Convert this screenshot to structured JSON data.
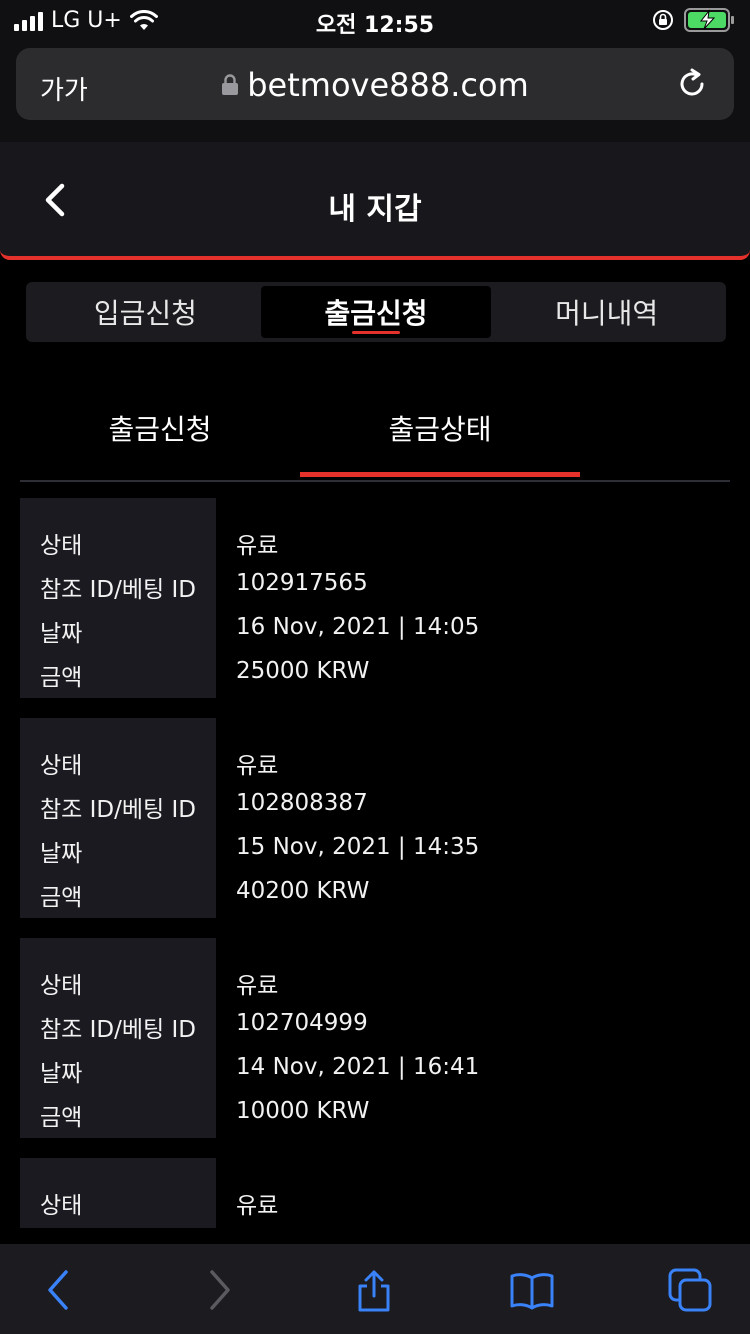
{
  "status_bar": {
    "carrier": "LG U+",
    "time": "오전 12:55"
  },
  "browser": {
    "text_size_label": "가가",
    "url": "betmove888.com"
  },
  "header": {
    "title": "내 지갑"
  },
  "segment_tabs": [
    {
      "label": "입금신청",
      "active": false
    },
    {
      "label": "출금신청",
      "active": true
    },
    {
      "label": "머니내역",
      "active": false
    }
  ],
  "sub_tabs": [
    {
      "label": "출금신청",
      "active": false
    },
    {
      "label": "출금상태",
      "active": true
    }
  ],
  "field_labels": {
    "status": "상태",
    "ref": "참조 ID/베팅 ID",
    "date": "날짜",
    "amount": "금액"
  },
  "records": [
    {
      "status": "유료",
      "ref": "102917565",
      "date": "16 Nov, 2021 | 14:05",
      "amount": "25000 KRW"
    },
    {
      "status": "유료",
      "ref": "102808387",
      "date": "15 Nov, 2021 | 14:35",
      "amount": "40200 KRW"
    },
    {
      "status": "유료",
      "ref": "102704999",
      "date": "14 Nov, 2021 | 16:41",
      "amount": "10000 KRW"
    },
    {
      "status": "유료"
    }
  ],
  "colors": {
    "accent": "#e5312b",
    "header_bg": "#18181c",
    "label_bg": "#1a1a20",
    "ios_blue": "#3a82f7"
  },
  "icons": {
    "back": "chevron-left-icon",
    "reload": "reload-icon",
    "lock": "lock-icon",
    "share": "share-icon",
    "bookmarks": "book-icon",
    "tabs": "tabs-icon"
  }
}
